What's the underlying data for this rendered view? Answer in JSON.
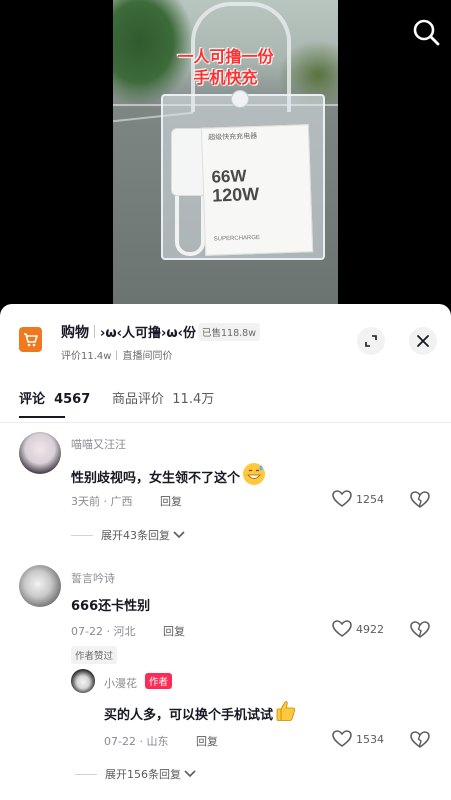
{
  "video": {
    "caption_line1": "一人可撸一份",
    "caption_line2": "手机快充",
    "box_brand": "超级快充充电器",
    "box_power_line1": "66W",
    "box_power_line2": "120W",
    "box_note": "SUPERCHARGE"
  },
  "toolbar": {
    "search_icon": "search-icon"
  },
  "shop": {
    "title": "购物",
    "product": "›ω‹人可撸›ω‹份",
    "sold": "已售118.8w",
    "rating": "评价11.4w",
    "live_price": "直播间同价",
    "logo_color": "#f0781e"
  },
  "tabs": [
    {
      "label": "评论",
      "count": "4567"
    },
    {
      "label": "商品评价",
      "count": "11.4万"
    }
  ],
  "comments": [
    {
      "user": "喵喵又汪汪",
      "text": "性别歧视吗，女生领不了这个",
      "emoji": "grinning-sweat-emoji",
      "time": "3天前",
      "location": "广西",
      "reply_label": "回复",
      "likes": "1254",
      "expand": "展开43条回复"
    },
    {
      "user": "誓言吟诗",
      "text": "666还卡性别",
      "time": "07-22",
      "location": "河北",
      "reply_label": "回复",
      "likes": "4922",
      "author_liked": "作者赞过"
    }
  ],
  "sub_reply": {
    "user": "小漫花",
    "badge": "作者",
    "text": "买的人多，可以换个手机试试",
    "emoji": "thumbs-up-emoji",
    "time": "07-22",
    "location": "山东",
    "reply_label": "回复",
    "likes": "1534"
  },
  "expand_more": "展开156条回复",
  "colors": {
    "accent_red": "#fe2c55",
    "text_primary": "#161823",
    "text_secondary": "#8a8b91"
  }
}
